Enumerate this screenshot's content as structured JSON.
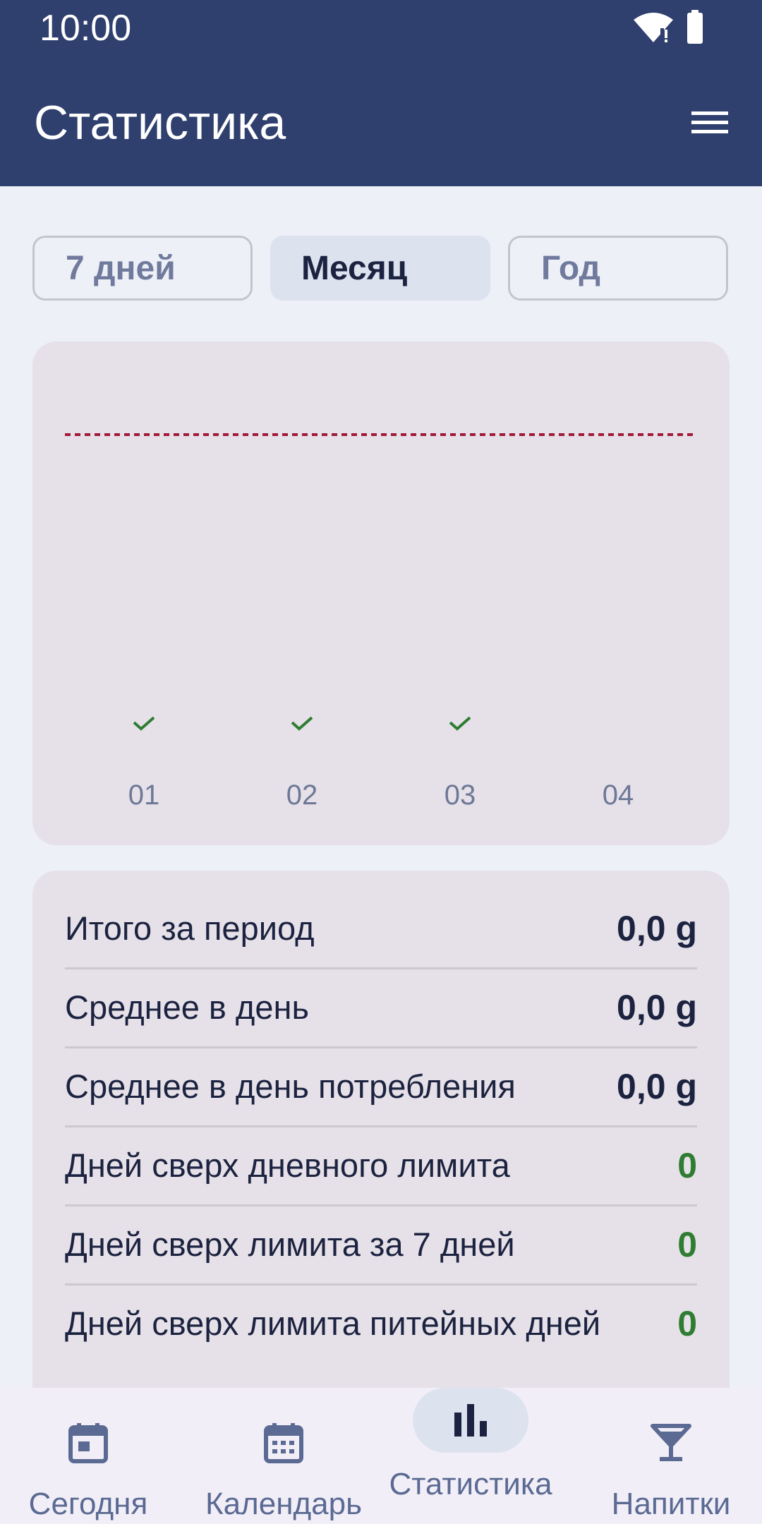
{
  "status_bar": {
    "time": "10:00"
  },
  "app_bar": {
    "title": "Статистика"
  },
  "segments": [
    {
      "label": "7 дней",
      "selected": false
    },
    {
      "label": "Месяц",
      "selected": true
    },
    {
      "label": "Год",
      "selected": false
    }
  ],
  "chart_data": {
    "type": "bar",
    "categories": [
      "01",
      "02",
      "03",
      "04"
    ],
    "values": [
      0,
      0,
      0,
      0
    ],
    "checked": [
      true,
      true,
      true,
      false
    ],
    "limit_line": true,
    "colors": {
      "limit": "#a21a3a",
      "check": "#2e7d32",
      "tick": "#6d7897"
    }
  },
  "stats": [
    {
      "label": "Итого за период",
      "value": "0,0 g",
      "green": false
    },
    {
      "label": "Среднее в день",
      "value": "0,0 g",
      "green": false
    },
    {
      "label": "Среднее в день потребления",
      "value": "0,0 g",
      "green": false
    },
    {
      "label": "Дней сверх дневного лимита",
      "value": "0",
      "green": true
    },
    {
      "label": "Дней сверх лимита за 7 дней",
      "value": "0",
      "green": true
    },
    {
      "label": "Дней сверх лимита питейных дней",
      "value": "0",
      "green": true
    }
  ],
  "bottom_nav": [
    {
      "label": "Сегодня",
      "icon": "calendar-today-icon",
      "active": false
    },
    {
      "label": "Календарь",
      "icon": "calendar-month-icon",
      "active": false
    },
    {
      "label": "Статистика",
      "icon": "bar-chart-icon",
      "active": true
    },
    {
      "label": "Напитки",
      "icon": "cocktail-icon",
      "active": false
    }
  ],
  "colors": {
    "primary": "#2f3f6e",
    "background": "#eef0f8",
    "card": "#e6e1e8",
    "accent_green": "#2e7d32"
  }
}
